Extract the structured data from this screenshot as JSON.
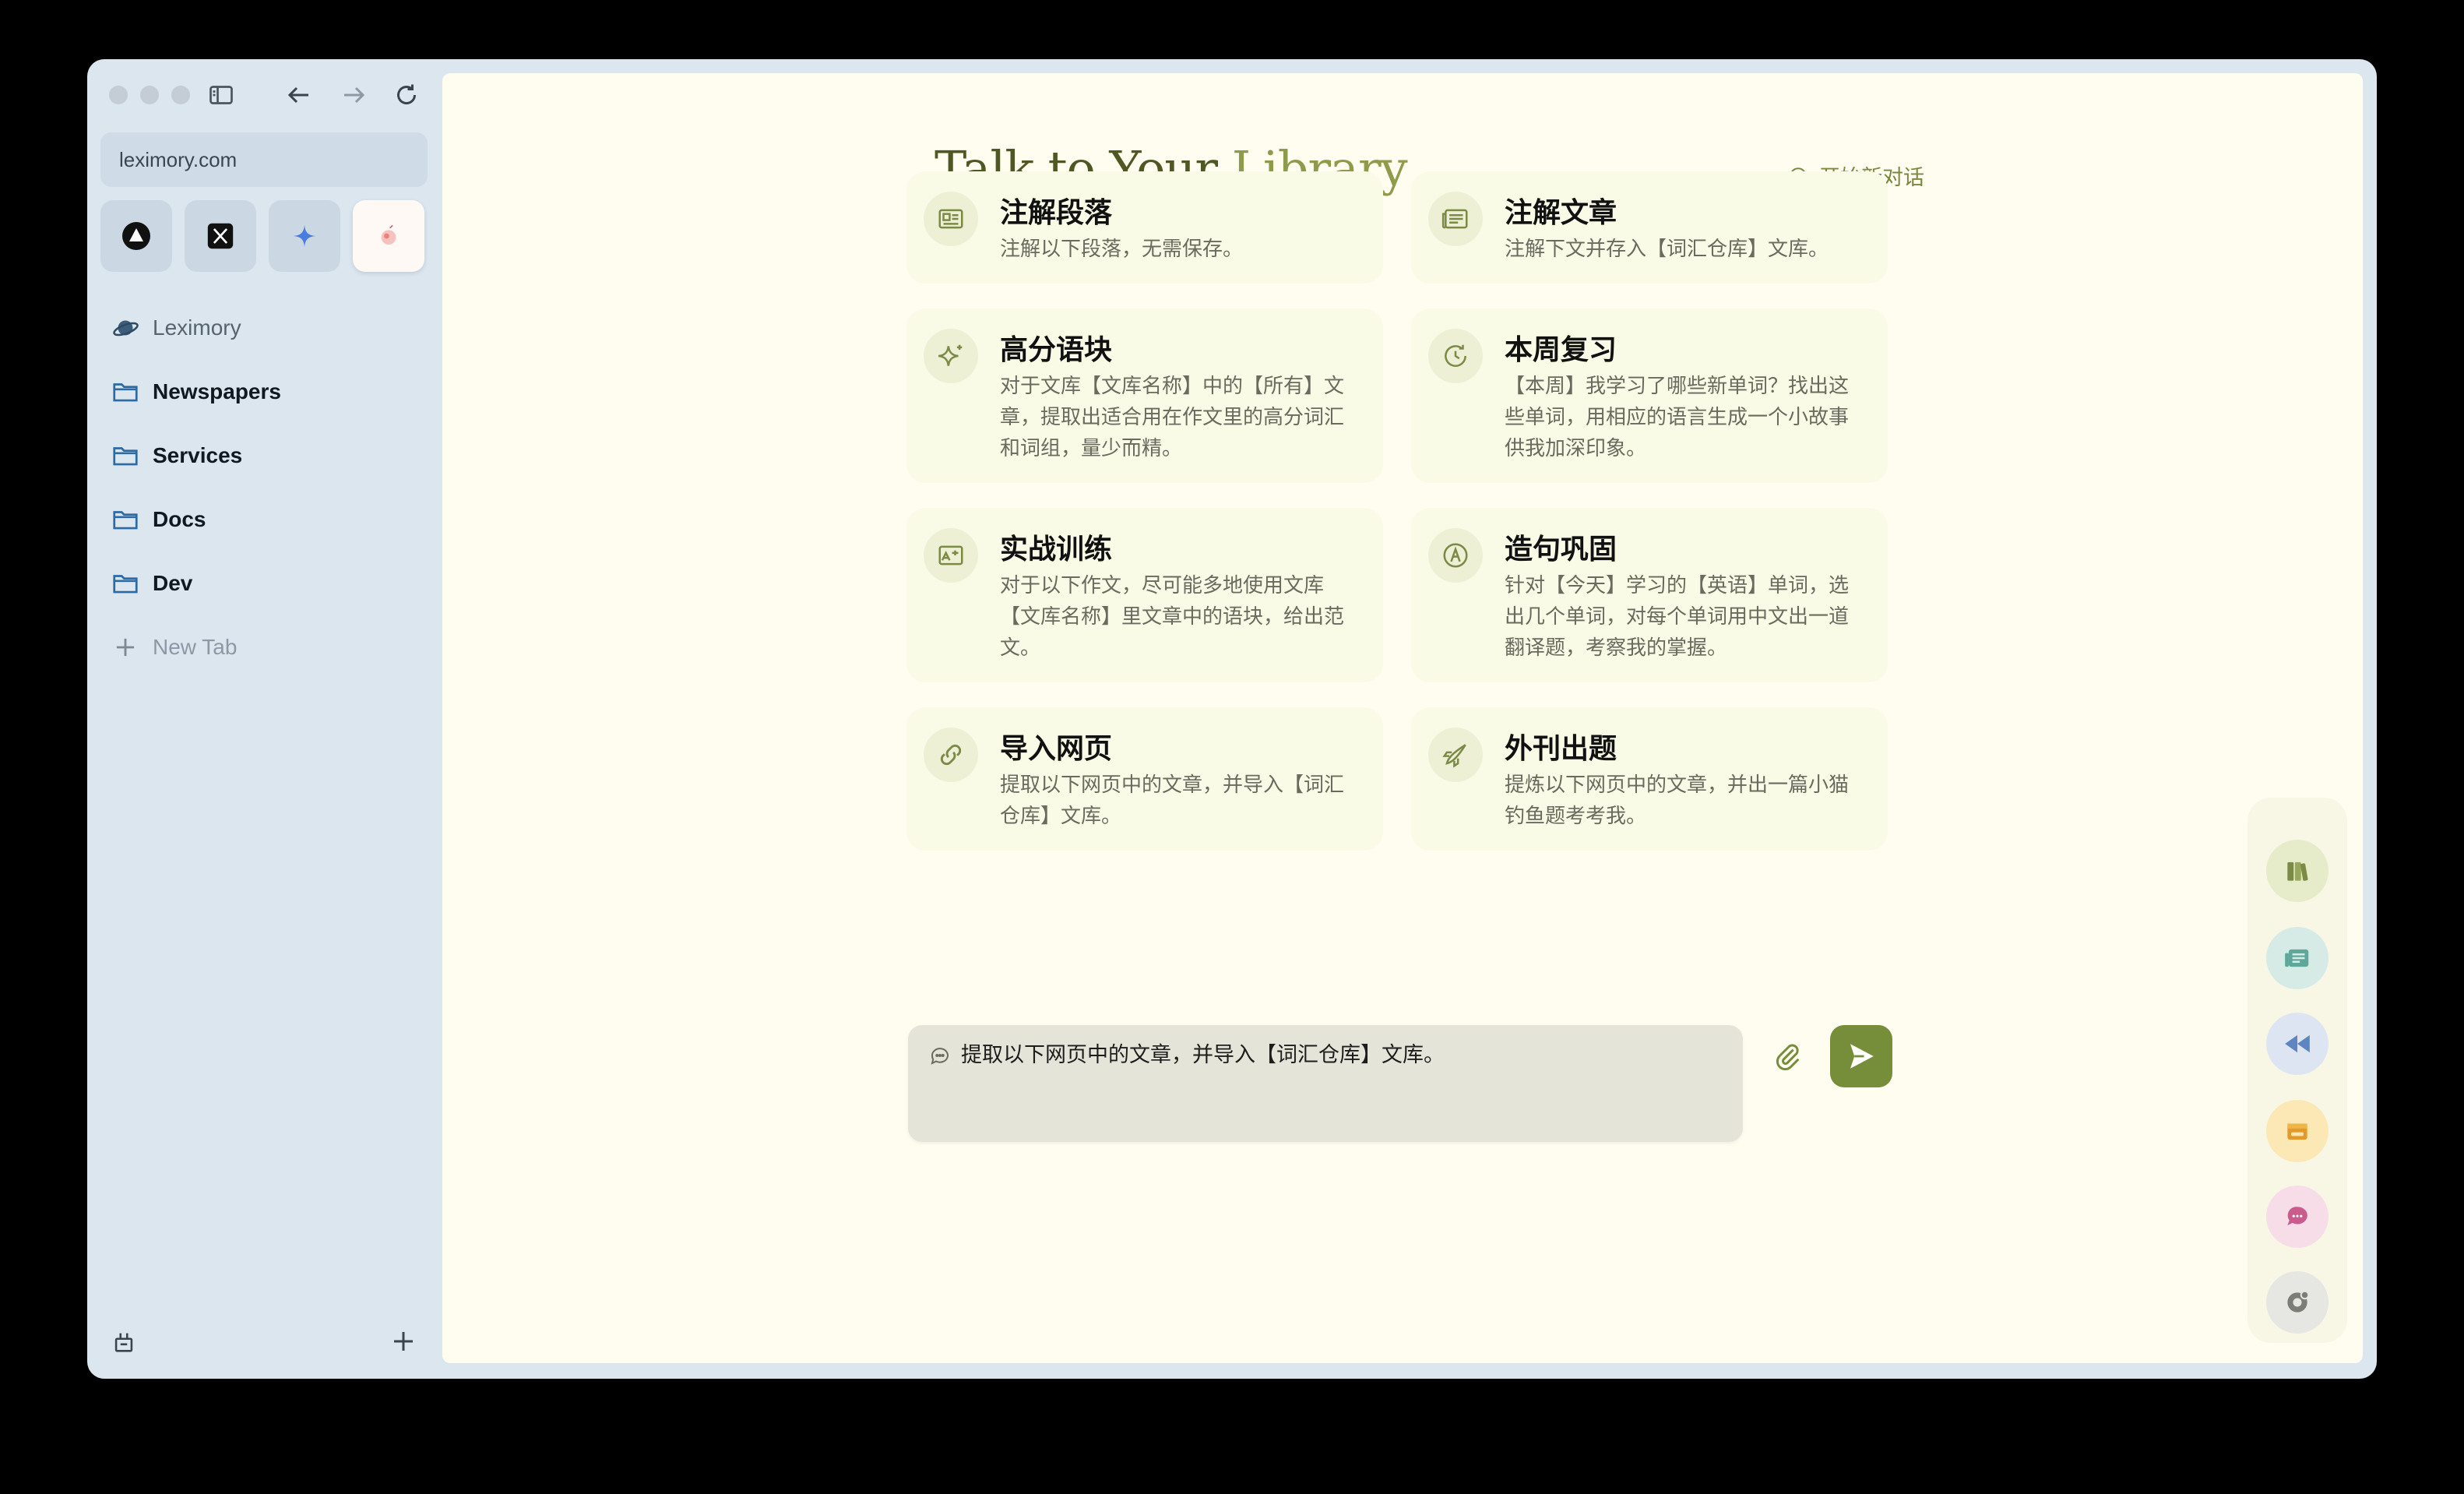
{
  "browser": {
    "url": "leximory.com",
    "favorites": [
      {
        "name": "Arc/Triangle",
        "icon": "triangle-circle-icon"
      },
      {
        "name": "X",
        "icon": "x-logo-icon"
      },
      {
        "name": "Gemini",
        "icon": "sparkle-icon"
      },
      {
        "name": "Leximory",
        "icon": "leximory-logo-icon"
      }
    ],
    "sidebar": {
      "items": [
        {
          "label": "Leximory",
          "icon": "planet-icon"
        },
        {
          "label": "Newspapers",
          "icon": "folder-icon"
        },
        {
          "label": "Services",
          "icon": "folder-icon"
        },
        {
          "label": "Docs",
          "icon": "folder-icon"
        },
        {
          "label": "Dev",
          "icon": "folder-icon"
        },
        {
          "label": "New Tab",
          "icon": "plus-icon"
        }
      ]
    }
  },
  "page": {
    "title_main": "Talk to Your ",
    "title_accent": "Library",
    "new_chat_label": "开始新对话",
    "accent_color": "#768e3a",
    "cards": [
      {
        "title": "注解段落",
        "desc": "注解以下段落，无需保存。",
        "icon": "news-icon"
      },
      {
        "title": "注解文章",
        "desc": "注解下文并存入【词汇仓库】文库。",
        "icon": "article-icon"
      },
      {
        "title": "高分语块",
        "desc": "对于文库【文库名称】中的【所有】文章，提取出适合用在作文里的高分词汇和词组，量少而精。",
        "icon": "sparkles-icon"
      },
      {
        "title": "本周复习",
        "desc": "【本周】我学习了哪些新单词？找出这些单词，用相应的语言生成一个小故事供我加深印象。",
        "icon": "clock-icon"
      },
      {
        "title": "实战训练",
        "desc": "对于以下作文，尽可能多地使用文库【文库名称】里文章中的语块，给出范文。",
        "icon": "image-text-icon"
      },
      {
        "title": "造句巩固",
        "desc": "针对【今天】学习的【英语】单词，选出几个单词，对每个单词用中文出一道翻译题，考察我的掌握。",
        "icon": "pen-circle-icon"
      },
      {
        "title": "导入网页",
        "desc": "提取以下网页中的文章，并导入【词汇仓库】文库。",
        "icon": "link-icon"
      },
      {
        "title": "外刊出题",
        "desc": "提炼以下网页中的文章，并出一篇小猫钓鱼题考考我。",
        "icon": "rocket-icon"
      }
    ],
    "composer_value": "提取以下网页中的文章，并导入【词汇仓库】文库。",
    "right_tools": [
      {
        "icon": "books-icon",
        "color": "#e6ecc9"
      },
      {
        "icon": "newspaper-icon",
        "color": "#d6eae6"
      },
      {
        "icon": "rewind-icon",
        "color": "#dde5f2"
      },
      {
        "icon": "store-icon",
        "color": "#fbe8b4"
      },
      {
        "icon": "chat-icon",
        "color": "#f7dde7"
      },
      {
        "icon": "settings-icon",
        "color": "#e6e6e2"
      }
    ]
  }
}
